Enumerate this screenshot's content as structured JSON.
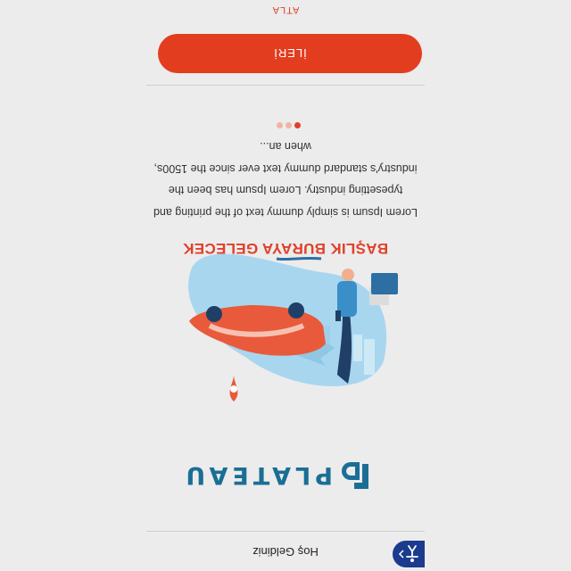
{
  "header": {
    "title": "Hoş Geldiniz"
  },
  "accessibility": {
    "icon": "accessibility-icon",
    "color": "#1b3b8f"
  },
  "logo": {
    "text": "PLATEAU",
    "color": "#1a6e95"
  },
  "illustration": {
    "icon": "parking-illustration"
  },
  "slide": {
    "title": "BAŞLIK BURAYA GELECEK",
    "body": "Lorem Ipsum is simply dummy text of the printing and typesetting industry. Lorem Ipsum has been the industry's standard dummy text ever since the 1500s, when an..."
  },
  "pager": {
    "count": 3,
    "active": 1,
    "active_color": "#e0402a"
  },
  "actions": {
    "next_label": "İLERİ",
    "skip_label": "ATLA",
    "accent": "#e33d1f"
  }
}
